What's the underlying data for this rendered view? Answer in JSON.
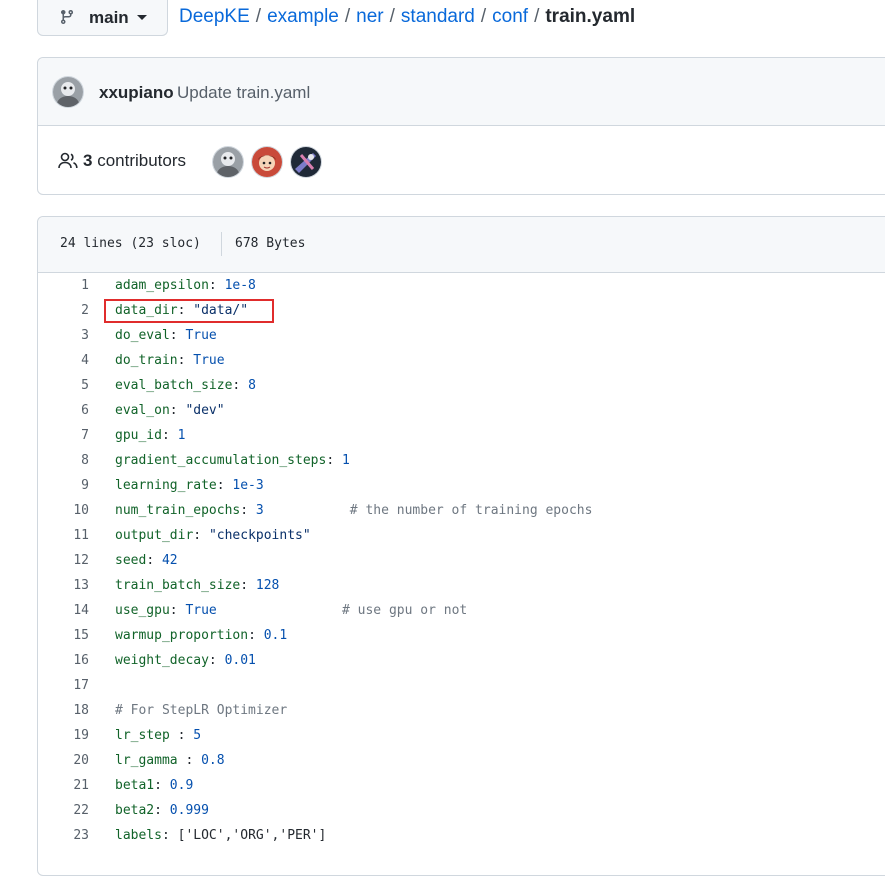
{
  "branch": {
    "name": "main"
  },
  "breadcrumb": {
    "items": [
      "DeepKE",
      "example",
      "ner",
      "standard",
      "conf"
    ],
    "separator": "/",
    "current": "train.yaml"
  },
  "commit": {
    "author": "xxupiano",
    "message": "Update train.yaml"
  },
  "contributors": {
    "count": "3",
    "label": "contributors"
  },
  "file": {
    "lines_info": "24 lines (23 sloc)",
    "size": "678 Bytes"
  },
  "code_lines": [
    {
      "n": "1",
      "key": "adam_epsilon",
      "sep": ": ",
      "val": "1e-8",
      "vtype": "v",
      "comment": ""
    },
    {
      "n": "2",
      "key": "data_dir",
      "sep": ": ",
      "val": "\"data/\"",
      "vtype": "s",
      "comment": ""
    },
    {
      "n": "3",
      "key": "do_eval",
      "sep": ": ",
      "val": "True",
      "vtype": "v",
      "comment": ""
    },
    {
      "n": "4",
      "key": "do_train",
      "sep": ": ",
      "val": "True",
      "vtype": "v",
      "comment": ""
    },
    {
      "n": "5",
      "key": "eval_batch_size",
      "sep": ": ",
      "val": "8",
      "vtype": "v",
      "comment": ""
    },
    {
      "n": "6",
      "key": "eval_on",
      "sep": ": ",
      "val": "\"dev\"",
      "vtype": "s",
      "comment": ""
    },
    {
      "n": "7",
      "key": "gpu_id",
      "sep": ": ",
      "val": "1",
      "vtype": "v",
      "comment": ""
    },
    {
      "n": "8",
      "key": "gradient_accumulation_steps",
      "sep": ": ",
      "val": "1",
      "vtype": "v",
      "comment": ""
    },
    {
      "n": "9",
      "key": "learning_rate",
      "sep": ": ",
      "val": "1e-3",
      "vtype": "v",
      "comment": ""
    },
    {
      "n": "10",
      "key": "num_train_epochs",
      "sep": ": ",
      "val": "3",
      "vtype": "v",
      "comment": "           # the number of training epochs"
    },
    {
      "n": "11",
      "key": "output_dir",
      "sep": ": ",
      "val": "\"checkpoints\"",
      "vtype": "s",
      "comment": ""
    },
    {
      "n": "12",
      "key": "seed",
      "sep": ": ",
      "val": "42",
      "vtype": "v",
      "comment": ""
    },
    {
      "n": "13",
      "key": "train_batch_size",
      "sep": ": ",
      "val": "128",
      "vtype": "v",
      "comment": ""
    },
    {
      "n": "14",
      "key": "use_gpu",
      "sep": ": ",
      "val": "True",
      "vtype": "v",
      "comment": "                # use gpu or not"
    },
    {
      "n": "15",
      "key": "warmup_proportion",
      "sep": ": ",
      "val": "0.1",
      "vtype": "v",
      "comment": ""
    },
    {
      "n": "16",
      "key": "weight_decay",
      "sep": ": ",
      "val": "0.01",
      "vtype": "v",
      "comment": ""
    },
    {
      "n": "17",
      "key": "",
      "sep": "",
      "val": "",
      "vtype": "v",
      "comment": ""
    },
    {
      "n": "18",
      "key": "",
      "sep": "",
      "val": "",
      "vtype": "v",
      "comment": "# For StepLR Optimizer"
    },
    {
      "n": "19",
      "key": "lr_step",
      "sep": " : ",
      "val": "5",
      "vtype": "v",
      "comment": ""
    },
    {
      "n": "20",
      "key": "lr_gamma",
      "sep": " : ",
      "val": "0.8",
      "vtype": "v",
      "comment": ""
    },
    {
      "n": "21",
      "key": "beta1",
      "sep": ": ",
      "val": "0.9",
      "vtype": "v",
      "comment": ""
    },
    {
      "n": "22",
      "key": "beta2",
      "sep": ": ",
      "val": "0.999",
      "vtype": "v",
      "comment": ""
    },
    {
      "n": "23",
      "key": "labels",
      "sep": ": ",
      "val": "['LOC','ORG','PER']",
      "vtype": "p",
      "comment": ""
    }
  ],
  "colors": {
    "link": "#0969da",
    "key": "#116329",
    "value": "#0550ae",
    "string": "#0a3069",
    "comment": "#6e7781",
    "highlight_border": "#e02c2c"
  }
}
